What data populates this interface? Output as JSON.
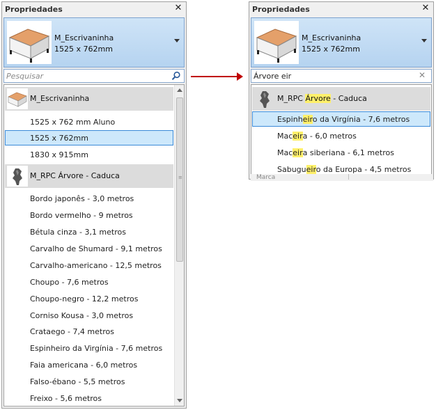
{
  "left_panel": {
    "title": "Propriedades",
    "selector": {
      "name": "M_Escrivaninha",
      "size": "1525 x 762mm"
    },
    "search": {
      "placeholder": "Pesquisar",
      "value": ""
    },
    "groups": [
      {
        "label": "M_Escrivaninha",
        "icon": "desk-icon"
      },
      {
        "label": "M_RPC Árvore - Caduca",
        "icon": "tree-icon"
      }
    ],
    "items": [
      "1525 x 762 mm Aluno",
      "1525 x 762mm",
      "1830 x 915mm",
      "Bordo japonês - 3,0 metros",
      "Bordo vermelho - 9 metros",
      "Bétula cinza - 3,1 metros",
      "Carvalho de Shumard - 9,1 metros",
      "Carvalho-americano - 12,5 metros",
      "Choupo - 7,6 metros",
      "Choupo-negro - 12,2 metros",
      "Corniso Kousa - 3,0 metros",
      "Crataego - 7,4 metros",
      "Espinheiro da Virgínia - 7,6 metros",
      "Faia americana - 6,0 metros",
      "Falso-ébano  - 5,5 metros",
      "Freixo - 5,6 metros"
    ]
  },
  "right_panel": {
    "title": "Propriedades",
    "selector": {
      "name": "M_Escrivaninha",
      "size": "1525 x 762mm"
    },
    "search": {
      "value": "Árvore eir"
    },
    "group": {
      "pre": "M_RPC ",
      "hl": "Árvore",
      "post": " - Caduca",
      "icon": "tree-icon"
    },
    "results": [
      {
        "pre": "Espinh",
        "hl": "eir",
        "post": "o da Virgínia - 7,6 metros"
      },
      {
        "pre": "Mac",
        "hl": "eir",
        "post": "a - 6,0 metros"
      },
      {
        "pre": "Mac",
        "hl": "eir",
        "post": "a siberiana - 6,1 metros"
      },
      {
        "pre": "Sabugu",
        "hl": "eir",
        "post": "o da Europa - 4,5 metros"
      }
    ],
    "underlap_label": "Marca"
  },
  "colors": {
    "accent": "#3b8ad8",
    "highlight": "#fff06a",
    "arrow": "#c00000"
  }
}
